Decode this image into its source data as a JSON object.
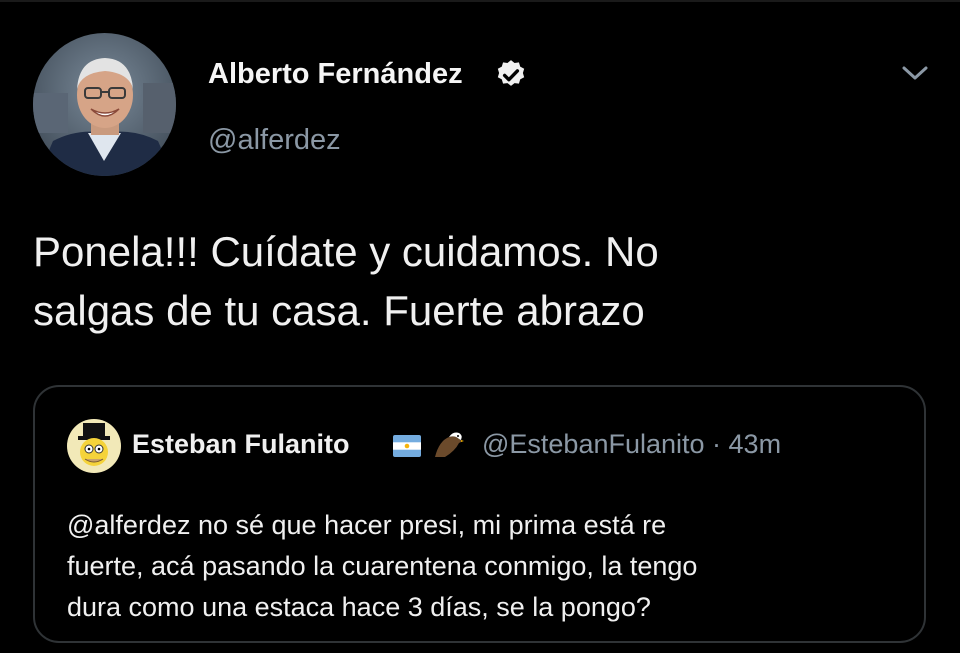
{
  "tweet": {
    "author_name": "Alberto Fernández",
    "handle": "@alferdez",
    "text_lines": [
      "Ponela!!! Cuídate y cuidamos. No",
      "salgas de tu casa. Fuerte abrazo"
    ],
    "verified_icon": "verified-badge-icon",
    "menu_icon": "chevron-down-icon"
  },
  "quoted_tweet": {
    "author_name": "Esteban Fulanito",
    "handle_time": "@EstebanFulanito · 43m",
    "text_lines": [
      "@alferdez no sé que hacer presi, mi prima está re",
      "fuerte, acá pasando la cuarentena conmigo, la tengo",
      "dura como una estaca hace 3 días, se la pongo?"
    ],
    "emoji": [
      "argentina-flag-icon",
      "eagle-icon"
    ]
  },
  "colors": {
    "background": "#000000",
    "text": "#f0f0f0",
    "secondary_text": "#8b98a5",
    "border": "#2f3336"
  }
}
